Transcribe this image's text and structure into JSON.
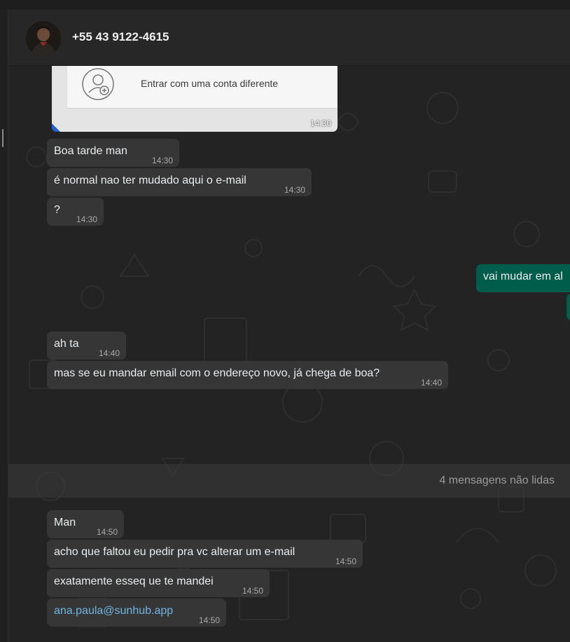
{
  "contact": {
    "name": "+55 43 9122-4615"
  },
  "image_message": {
    "caption": "Entrar com uma conta diferente",
    "time": "14:30"
  },
  "messages": [
    {
      "text": "Boa tarde man",
      "time": "14:30"
    },
    {
      "text": "é normal nao ter mudado aqui o e-mail",
      "time": "14:30"
    },
    {
      "text": "?",
      "time": "14:30"
    },
    {
      "text": "vai mudar em al",
      "time": ""
    },
    {
      "text": "ah ta",
      "time": "14:40"
    },
    {
      "text": "mas se eu mandar email com o endereço novo, já chega de boa?",
      "time": "14:40"
    },
    {
      "text": "Man",
      "time": "14:50"
    },
    {
      "text": "acho que faltou eu pedir pra vc alterar um e-mail",
      "time": "14:50"
    },
    {
      "text": "exatamente esseq ue te mandei",
      "time": "14:50"
    },
    {
      "text": "ana.paula@sunhub.app",
      "time": "14:50"
    }
  ],
  "unread_divider": {
    "label": "4 mensagens não lidas"
  },
  "colors": {
    "incoming": "#363636",
    "outgoing": "#005c4b",
    "link": "#6fb5e0"
  },
  "icons": {
    "account": "add-account-icon"
  }
}
